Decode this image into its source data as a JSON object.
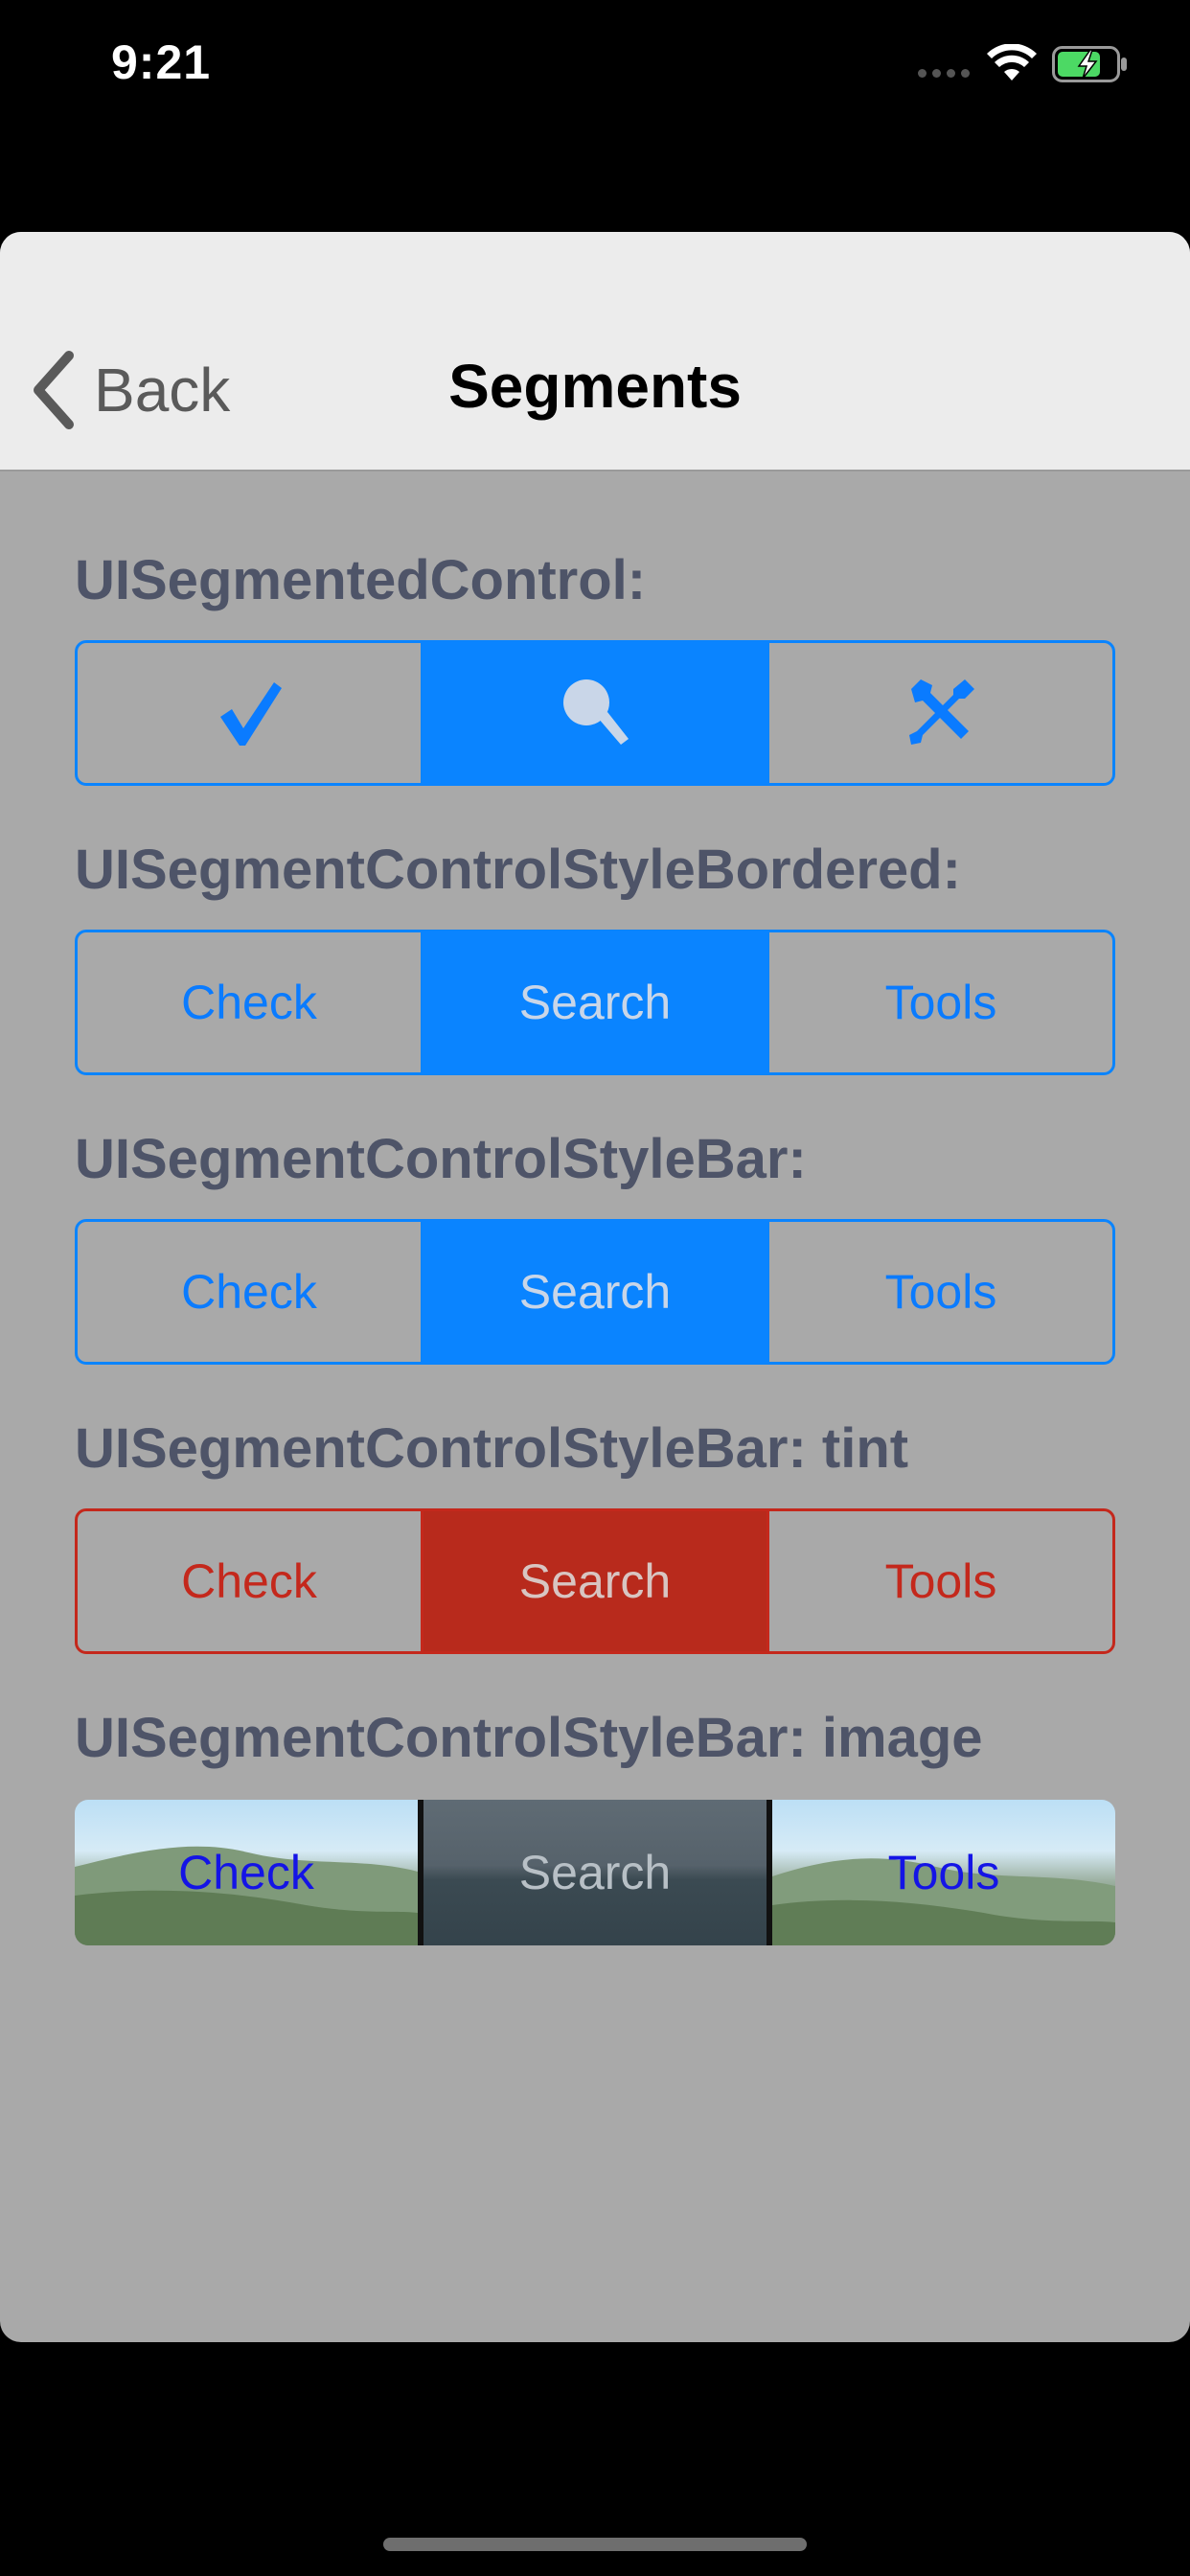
{
  "status_bar": {
    "time": "9:21"
  },
  "nav": {
    "back_label": "Back",
    "title": "Segments"
  },
  "sections": {
    "control": {
      "label": "UISegmentedControl:",
      "segments": [
        "check-icon",
        "search-icon",
        "tools-icon"
      ],
      "selected_index": 1
    },
    "bordered": {
      "label": "UISegmentControlStyleBordered:",
      "segments": [
        "Check",
        "Search",
        "Tools"
      ],
      "selected_index": 1
    },
    "bar": {
      "label": "UISegmentControlStyleBar:",
      "segments": [
        "Check",
        "Search",
        "Tools"
      ],
      "selected_index": 1
    },
    "tint": {
      "label": "UISegmentControlStyleBar: tint",
      "segments": [
        "Check",
        "Search",
        "Tools"
      ],
      "selected_index": 1
    },
    "image": {
      "label": "UISegmentControlStyleBar: image",
      "segments": [
        "Check",
        "Search",
        "Tools"
      ],
      "selected_index": 1
    }
  },
  "colors": {
    "accent": "#0a84ff",
    "tint": "#c4281c",
    "sheet_background": "#a9a9a9",
    "nav_background": "#ececec",
    "label_text": "#4e5468"
  }
}
